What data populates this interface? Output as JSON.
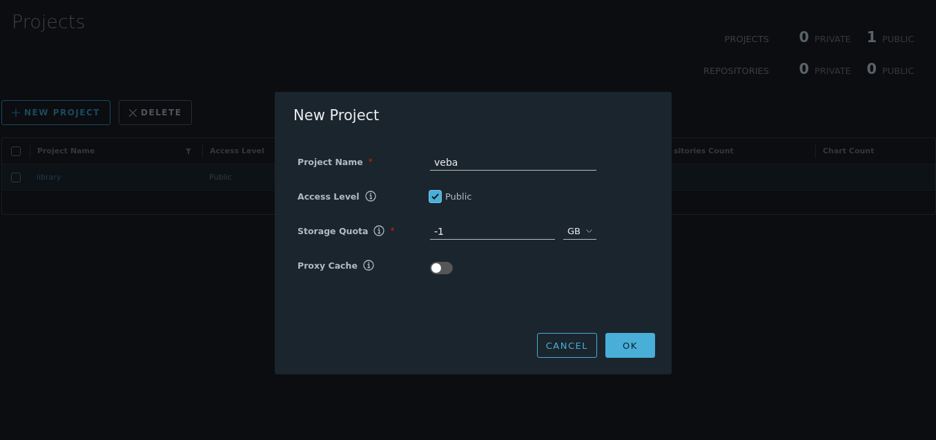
{
  "page": {
    "title": "Projects"
  },
  "summary": [
    {
      "label": "PROJECTS",
      "private_count": "0",
      "private_label": "PRIVATE",
      "public_count": "1",
      "public_label": "PUBLIC"
    },
    {
      "label": "REPOSITORIES",
      "private_count": "0",
      "private_label": "PRIVATE",
      "public_count": "0",
      "public_label": "PUBLIC"
    }
  ],
  "toolbar": [
    {
      "label": "NEW PROJECT",
      "disabled": false
    },
    {
      "label": "DELETE",
      "disabled": true
    }
  ],
  "table": {
    "select_all": {
      "checked": false
    },
    "columns": [
      {
        "label": "Project Name",
        "filter": true
      },
      {
        "label": "Access Level"
      },
      {
        "label": "sitories Count"
      },
      {
        "label": "Chart Count"
      }
    ],
    "rows": [
      {
        "selected": false,
        "cells": [
          "library",
          "Public"
        ]
      }
    ]
  },
  "dialog": {
    "title": "New Project",
    "fields": [
      {
        "kind": "text",
        "label": "Project Name",
        "info": false,
        "required_mark": "*",
        "value": "veba"
      },
      {
        "kind": "checkbox",
        "label": "Access Level",
        "info": true,
        "checked": true,
        "option": "Public"
      },
      {
        "kind": "quota",
        "label": "Storage Quota",
        "info": true,
        "required_mark": "*",
        "value": "-1",
        "unit": "GB"
      },
      {
        "kind": "toggle",
        "label": "Proxy Cache",
        "info": true,
        "on": false
      }
    ],
    "buttons": [
      {
        "label": "CANCEL",
        "kind": "outline"
      },
      {
        "label": "OK",
        "kind": "primary"
      }
    ]
  }
}
